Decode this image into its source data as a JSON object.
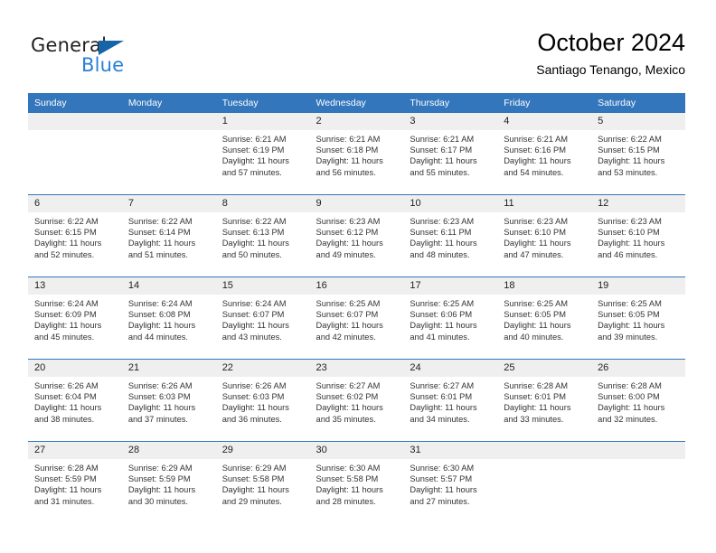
{
  "logo": {
    "word_one": "General",
    "word_two": "Blue",
    "triangle_icon": "triangle-icon",
    "colors": {
      "general_text": "#231f20",
      "blue_text": "#2980d6",
      "triangle": "#1565a8"
    }
  },
  "header": {
    "title": "October 2024",
    "subtitle": "Santiago Tenango, Mexico"
  },
  "theme": {
    "header_row_bg": "#3376bb",
    "daynum_bg": "#efefef",
    "week_separator": "#3376bb"
  },
  "weekday_headers": [
    "Sunday",
    "Monday",
    "Tuesday",
    "Wednesday",
    "Thursday",
    "Friday",
    "Saturday"
  ],
  "weeks": [
    [
      {
        "day": "",
        "empty": true,
        "sunrise": "",
        "sunset": "",
        "daylight_line1": "",
        "daylight_line2": ""
      },
      {
        "day": "",
        "empty": true,
        "sunrise": "",
        "sunset": "",
        "daylight_line1": "",
        "daylight_line2": ""
      },
      {
        "day": "1",
        "sunrise": "Sunrise: 6:21 AM",
        "sunset": "Sunset: 6:19 PM",
        "daylight_line1": "Daylight: 11 hours",
        "daylight_line2": "and 57 minutes."
      },
      {
        "day": "2",
        "sunrise": "Sunrise: 6:21 AM",
        "sunset": "Sunset: 6:18 PM",
        "daylight_line1": "Daylight: 11 hours",
        "daylight_line2": "and 56 minutes."
      },
      {
        "day": "3",
        "sunrise": "Sunrise: 6:21 AM",
        "sunset": "Sunset: 6:17 PM",
        "daylight_line1": "Daylight: 11 hours",
        "daylight_line2": "and 55 minutes."
      },
      {
        "day": "4",
        "sunrise": "Sunrise: 6:21 AM",
        "sunset": "Sunset: 6:16 PM",
        "daylight_line1": "Daylight: 11 hours",
        "daylight_line2": "and 54 minutes."
      },
      {
        "day": "5",
        "sunrise": "Sunrise: 6:22 AM",
        "sunset": "Sunset: 6:15 PM",
        "daylight_line1": "Daylight: 11 hours",
        "daylight_line2": "and 53 minutes."
      }
    ],
    [
      {
        "day": "6",
        "sunrise": "Sunrise: 6:22 AM",
        "sunset": "Sunset: 6:15 PM",
        "daylight_line1": "Daylight: 11 hours",
        "daylight_line2": "and 52 minutes."
      },
      {
        "day": "7",
        "sunrise": "Sunrise: 6:22 AM",
        "sunset": "Sunset: 6:14 PM",
        "daylight_line1": "Daylight: 11 hours",
        "daylight_line2": "and 51 minutes."
      },
      {
        "day": "8",
        "sunrise": "Sunrise: 6:22 AM",
        "sunset": "Sunset: 6:13 PM",
        "daylight_line1": "Daylight: 11 hours",
        "daylight_line2": "and 50 minutes."
      },
      {
        "day": "9",
        "sunrise": "Sunrise: 6:23 AM",
        "sunset": "Sunset: 6:12 PM",
        "daylight_line1": "Daylight: 11 hours",
        "daylight_line2": "and 49 minutes."
      },
      {
        "day": "10",
        "sunrise": "Sunrise: 6:23 AM",
        "sunset": "Sunset: 6:11 PM",
        "daylight_line1": "Daylight: 11 hours",
        "daylight_line2": "and 48 minutes."
      },
      {
        "day": "11",
        "sunrise": "Sunrise: 6:23 AM",
        "sunset": "Sunset: 6:10 PM",
        "daylight_line1": "Daylight: 11 hours",
        "daylight_line2": "and 47 minutes."
      },
      {
        "day": "12",
        "sunrise": "Sunrise: 6:23 AM",
        "sunset": "Sunset: 6:10 PM",
        "daylight_line1": "Daylight: 11 hours",
        "daylight_line2": "and 46 minutes."
      }
    ],
    [
      {
        "day": "13",
        "sunrise": "Sunrise: 6:24 AM",
        "sunset": "Sunset: 6:09 PM",
        "daylight_line1": "Daylight: 11 hours",
        "daylight_line2": "and 45 minutes."
      },
      {
        "day": "14",
        "sunrise": "Sunrise: 6:24 AM",
        "sunset": "Sunset: 6:08 PM",
        "daylight_line1": "Daylight: 11 hours",
        "daylight_line2": "and 44 minutes."
      },
      {
        "day": "15",
        "sunrise": "Sunrise: 6:24 AM",
        "sunset": "Sunset: 6:07 PM",
        "daylight_line1": "Daylight: 11 hours",
        "daylight_line2": "and 43 minutes."
      },
      {
        "day": "16",
        "sunrise": "Sunrise: 6:25 AM",
        "sunset": "Sunset: 6:07 PM",
        "daylight_line1": "Daylight: 11 hours",
        "daylight_line2": "and 42 minutes."
      },
      {
        "day": "17",
        "sunrise": "Sunrise: 6:25 AM",
        "sunset": "Sunset: 6:06 PM",
        "daylight_line1": "Daylight: 11 hours",
        "daylight_line2": "and 41 minutes."
      },
      {
        "day": "18",
        "sunrise": "Sunrise: 6:25 AM",
        "sunset": "Sunset: 6:05 PM",
        "daylight_line1": "Daylight: 11 hours",
        "daylight_line2": "and 40 minutes."
      },
      {
        "day": "19",
        "sunrise": "Sunrise: 6:25 AM",
        "sunset": "Sunset: 6:05 PM",
        "daylight_line1": "Daylight: 11 hours",
        "daylight_line2": "and 39 minutes."
      }
    ],
    [
      {
        "day": "20",
        "sunrise": "Sunrise: 6:26 AM",
        "sunset": "Sunset: 6:04 PM",
        "daylight_line1": "Daylight: 11 hours",
        "daylight_line2": "and 38 minutes."
      },
      {
        "day": "21",
        "sunrise": "Sunrise: 6:26 AM",
        "sunset": "Sunset: 6:03 PM",
        "daylight_line1": "Daylight: 11 hours",
        "daylight_line2": "and 37 minutes."
      },
      {
        "day": "22",
        "sunrise": "Sunrise: 6:26 AM",
        "sunset": "Sunset: 6:03 PM",
        "daylight_line1": "Daylight: 11 hours",
        "daylight_line2": "and 36 minutes."
      },
      {
        "day": "23",
        "sunrise": "Sunrise: 6:27 AM",
        "sunset": "Sunset: 6:02 PM",
        "daylight_line1": "Daylight: 11 hours",
        "daylight_line2": "and 35 minutes."
      },
      {
        "day": "24",
        "sunrise": "Sunrise: 6:27 AM",
        "sunset": "Sunset: 6:01 PM",
        "daylight_line1": "Daylight: 11 hours",
        "daylight_line2": "and 34 minutes."
      },
      {
        "day": "25",
        "sunrise": "Sunrise: 6:28 AM",
        "sunset": "Sunset: 6:01 PM",
        "daylight_line1": "Daylight: 11 hours",
        "daylight_line2": "and 33 minutes."
      },
      {
        "day": "26",
        "sunrise": "Sunrise: 6:28 AM",
        "sunset": "Sunset: 6:00 PM",
        "daylight_line1": "Daylight: 11 hours",
        "daylight_line2": "and 32 minutes."
      }
    ],
    [
      {
        "day": "27",
        "sunrise": "Sunrise: 6:28 AM",
        "sunset": "Sunset: 5:59 PM",
        "daylight_line1": "Daylight: 11 hours",
        "daylight_line2": "and 31 minutes."
      },
      {
        "day": "28",
        "sunrise": "Sunrise: 6:29 AM",
        "sunset": "Sunset: 5:59 PM",
        "daylight_line1": "Daylight: 11 hours",
        "daylight_line2": "and 30 minutes."
      },
      {
        "day": "29",
        "sunrise": "Sunrise: 6:29 AM",
        "sunset": "Sunset: 5:58 PM",
        "daylight_line1": "Daylight: 11 hours",
        "daylight_line2": "and 29 minutes."
      },
      {
        "day": "30",
        "sunrise": "Sunrise: 6:30 AM",
        "sunset": "Sunset: 5:58 PM",
        "daylight_line1": "Daylight: 11 hours",
        "daylight_line2": "and 28 minutes."
      },
      {
        "day": "31",
        "sunrise": "Sunrise: 6:30 AM",
        "sunset": "Sunset: 5:57 PM",
        "daylight_line1": "Daylight: 11 hours",
        "daylight_line2": "and 27 minutes."
      },
      {
        "day": "",
        "empty": true,
        "sunrise": "",
        "sunset": "",
        "daylight_line1": "",
        "daylight_line2": ""
      },
      {
        "day": "",
        "empty": true,
        "sunrise": "",
        "sunset": "",
        "daylight_line1": "",
        "daylight_line2": ""
      }
    ]
  ]
}
